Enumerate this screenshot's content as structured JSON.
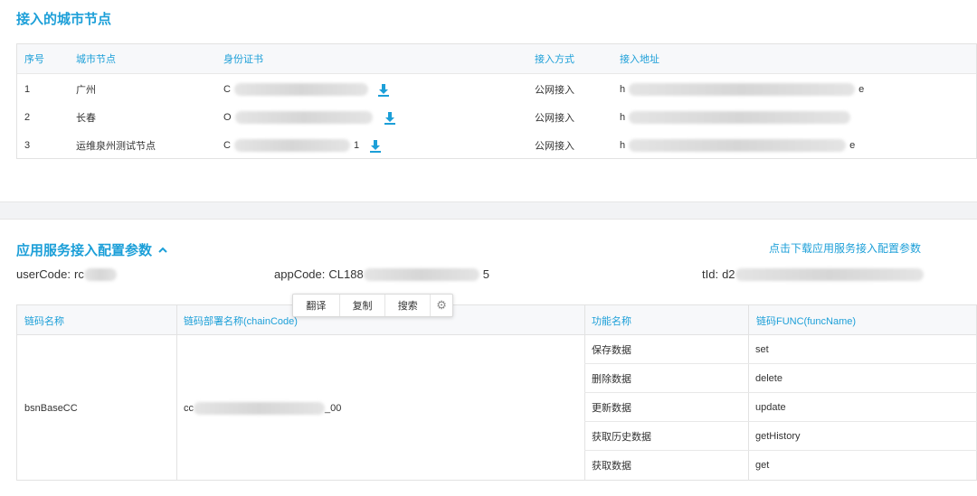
{
  "nodes_section": {
    "title": "接入的城市节点",
    "columns": {
      "index": "序号",
      "city": "城市节点",
      "cert": "身份证书",
      "method": "接入方式",
      "address": "接入地址"
    },
    "rows": [
      {
        "index": "1",
        "city": "广州",
        "cert_start": "C",
        "cert_end": "",
        "method": "公网接入",
        "addr_start": "h",
        "addr_end": "e"
      },
      {
        "index": "2",
        "city": "长春",
        "cert_start": "O",
        "cert_end": "",
        "method": "公网接入",
        "addr_start": "h",
        "addr_end": ""
      },
      {
        "index": "3",
        "city": "运维泉州测试节点",
        "cert_start": "C",
        "cert_end": "1",
        "method": "公网接入",
        "addr_start": "h",
        "addr_end": "e"
      }
    ]
  },
  "config_section": {
    "title": "应用服务接入配置参数",
    "collapse_icon": "chevron-up-icon",
    "download_link": "点击下载应用服务接入配置参数",
    "user_code": {
      "label": "userCode:",
      "value_start": "rc"
    },
    "app_code": {
      "label": "appCode:",
      "value_start": "CL188",
      "value_end": "5"
    },
    "tid": {
      "label": "tId:",
      "value_start": "d2"
    },
    "columns": {
      "chain_name": "链码名称",
      "chain_code": "链码部署名称(chainCode)",
      "func_name": "功能名称",
      "func": "链码FUNC(funcName)"
    },
    "chain_name": "bsnBaseCC",
    "chain_code_start": "cc",
    "chain_code_end": "_00",
    "functions": [
      {
        "name": "保存数据",
        "func": "set"
      },
      {
        "name": "删除数据",
        "func": "delete"
      },
      {
        "name": "更新数据",
        "func": "update"
      },
      {
        "name": "获取历史数据",
        "func": "getHistory"
      },
      {
        "name": "获取数据",
        "func": "get"
      }
    ]
  },
  "context_toolbar": {
    "translate": "翻译",
    "copy": "复制",
    "search": "搜索",
    "settings_icon": "gear-icon"
  },
  "colors": {
    "accent": "#1c9fd8",
    "text": "#333333",
    "header_bg": "#f7f8fa",
    "border": "#e2e2e2"
  }
}
